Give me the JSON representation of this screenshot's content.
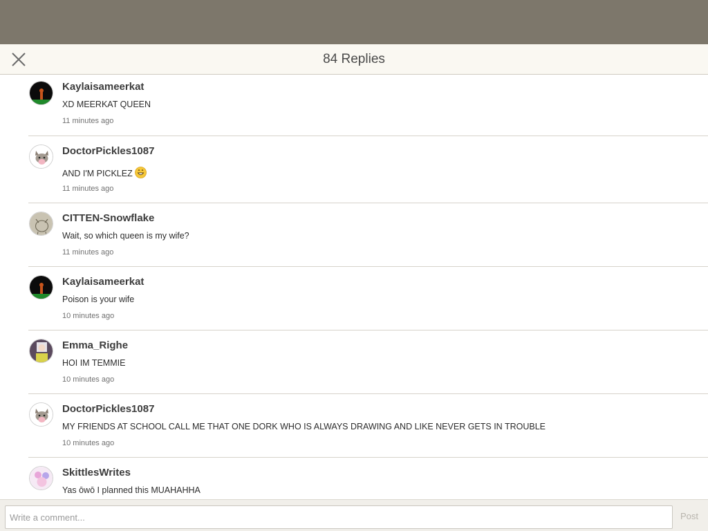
{
  "header": {
    "title": "84 Replies",
    "close_icon": "close-icon"
  },
  "replies": [
    {
      "username": "Kaylaisameerkat",
      "message": "XD MEERKAT QUEEN",
      "time": "11 minutes ago",
      "avatar": "meerkat-avatar"
    },
    {
      "username": "DoctorPickles1087",
      "message": "AND I'M PICKLEZ",
      "emoji": "😄",
      "time": "11 minutes ago",
      "avatar": "cat-avatar"
    },
    {
      "username": "CITTEN-Snowflake",
      "message": "Wait, so which queen is my wife?",
      "time": "11 minutes ago",
      "avatar": "sketch-cat-avatar"
    },
    {
      "username": "Kaylaisameerkat",
      "message": "Poison is your wife",
      "time": "10 minutes ago",
      "avatar": "meerkat-avatar"
    },
    {
      "username": "Emma_Righe",
      "message": "HOI IM TEMMIE",
      "time": "10 minutes ago",
      "avatar": "character-avatar"
    },
    {
      "username": "DoctorPickles1087",
      "message": "MY FRIENDS AT SCHOOL CALL ME THAT ONE DORK WHO IS ALWAYS DRAWING AND LIKE NEVER GETS IN TROUBLE",
      "time": "10 minutes ago",
      "avatar": "cat-avatar"
    },
    {
      "username": "SkittlesWrites",
      "message": "Yas ōwō I planned this MUAHAHHA",
      "time": "",
      "avatar": "pastel-avatar"
    }
  ],
  "composer": {
    "placeholder": "Write a comment...",
    "post_label": "Post"
  },
  "colors": {
    "top_bar": "#7d776b",
    "header_bg": "#faf8f2",
    "footer_bg": "#f1efea"
  }
}
